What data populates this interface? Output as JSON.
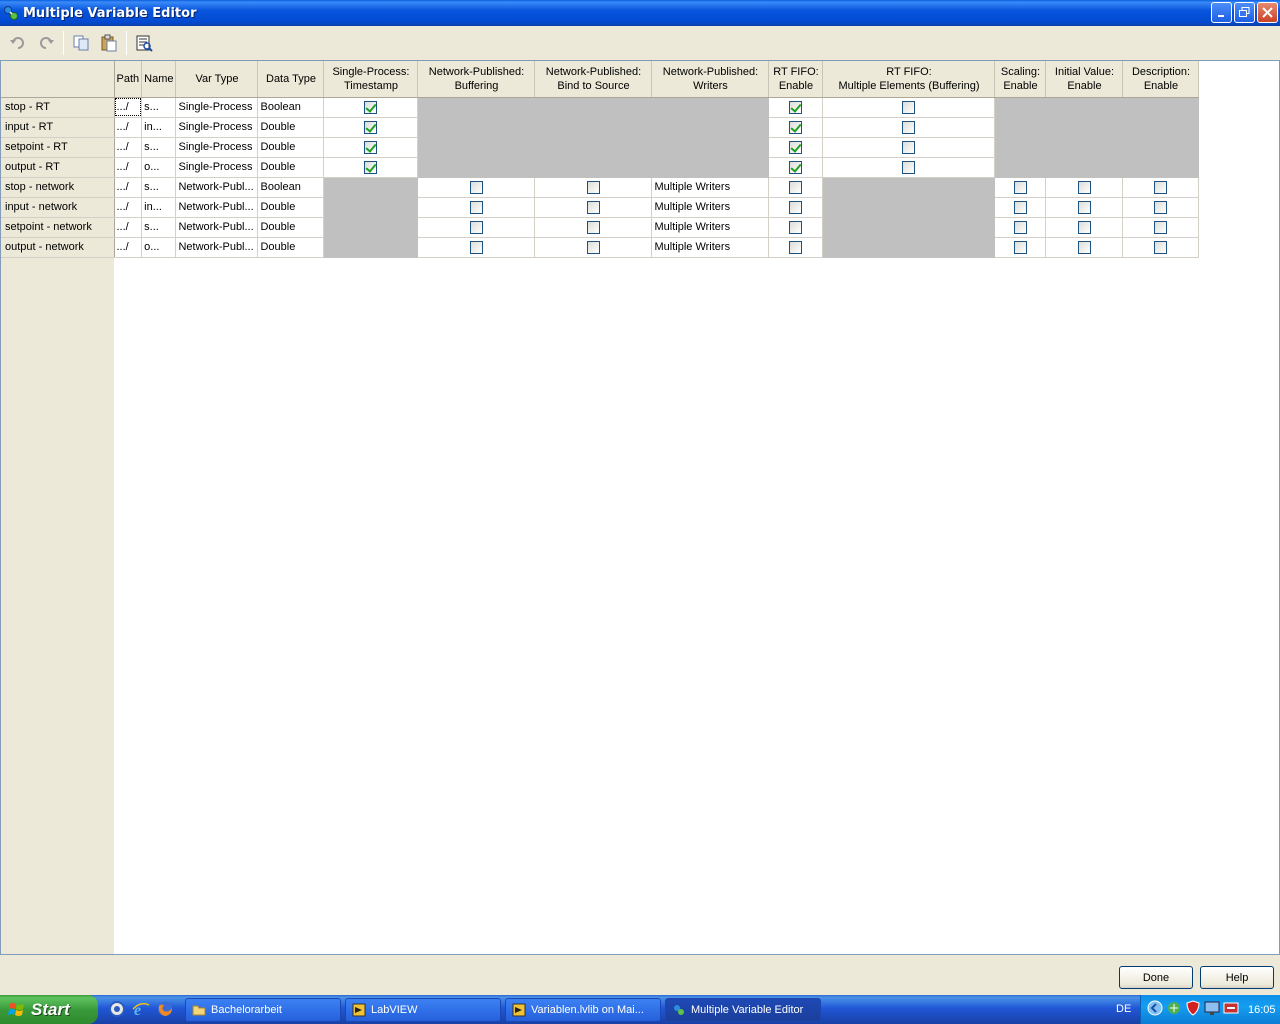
{
  "window": {
    "title": "Multiple Variable Editor"
  },
  "toolbar": {
    "icons": [
      "undo-icon",
      "redo-icon",
      "copy-icon",
      "paste-icon",
      "browse-icon"
    ]
  },
  "grid": {
    "columns": [
      {
        "key": "path",
        "label": "Path"
      },
      {
        "key": "name",
        "label": "Name"
      },
      {
        "key": "vartype",
        "label": "Var Type"
      },
      {
        "key": "datatype",
        "label": "Data Type"
      },
      {
        "key": "sp_ts",
        "label": "Single-Process:\nTimestamp"
      },
      {
        "key": "np_buf",
        "label": "Network-Published:\nBuffering"
      },
      {
        "key": "np_bind",
        "label": "Network-Published:\nBind to Source"
      },
      {
        "key": "np_writers",
        "label": "Network-Published:\nWriters"
      },
      {
        "key": "rt_en",
        "label": "RT FIFO:\nEnable"
      },
      {
        "key": "rt_multi",
        "label": "RT FIFO:\nMultiple Elements (Buffering)"
      },
      {
        "key": "sc_en",
        "label": "Scaling:\nEnable"
      },
      {
        "key": "iv_en",
        "label": "Initial Value:\nEnable"
      },
      {
        "key": "ds_en",
        "label": "Description:\nEnable"
      }
    ],
    "rows": [
      {
        "label": "stop - RT",
        "path": ".../",
        "name": "s...",
        "vartype": "Single-Process",
        "datatype": "Boolean",
        "sp_ts": true,
        "np_buf": null,
        "np_bind": null,
        "np_writers": null,
        "rt_en": true,
        "rt_multi": false,
        "sc_en": null,
        "iv_en": null,
        "ds_en": null
      },
      {
        "label": "input - RT",
        "path": ".../",
        "name": "in...",
        "vartype": "Single-Process",
        "datatype": "Double",
        "sp_ts": true,
        "np_buf": null,
        "np_bind": null,
        "np_writers": null,
        "rt_en": true,
        "rt_multi": false,
        "sc_en": null,
        "iv_en": null,
        "ds_en": null
      },
      {
        "label": "setpoint - RT",
        "path": ".../",
        "name": "s...",
        "vartype": "Single-Process",
        "datatype": "Double",
        "sp_ts": true,
        "np_buf": null,
        "np_bind": null,
        "np_writers": null,
        "rt_en": true,
        "rt_multi": false,
        "sc_en": null,
        "iv_en": null,
        "ds_en": null
      },
      {
        "label": "output - RT",
        "path": ".../",
        "name": "o...",
        "vartype": "Single-Process",
        "datatype": "Double",
        "sp_ts": true,
        "np_buf": null,
        "np_bind": null,
        "np_writers": null,
        "rt_en": true,
        "rt_multi": false,
        "sc_en": null,
        "iv_en": null,
        "ds_en": null
      },
      {
        "label": "stop - network",
        "path": ".../",
        "name": "s...",
        "vartype": "Network-Publ...",
        "datatype": "Boolean",
        "sp_ts": null,
        "np_buf": false,
        "np_bind": false,
        "np_writers": "Multiple Writers",
        "rt_en": false,
        "rt_multi": null,
        "sc_en": false,
        "iv_en": false,
        "ds_en": false
      },
      {
        "label": "input - network",
        "path": ".../",
        "name": "in...",
        "vartype": "Network-Publ...",
        "datatype": "Double",
        "sp_ts": null,
        "np_buf": false,
        "np_bind": false,
        "np_writers": "Multiple Writers",
        "rt_en": false,
        "rt_multi": null,
        "sc_en": false,
        "iv_en": false,
        "ds_en": false
      },
      {
        "label": "setpoint - network",
        "path": ".../",
        "name": "s...",
        "vartype": "Network-Publ...",
        "datatype": "Double",
        "sp_ts": null,
        "np_buf": false,
        "np_bind": false,
        "np_writers": "Multiple Writers",
        "rt_en": false,
        "rt_multi": null,
        "sc_en": false,
        "iv_en": false,
        "ds_en": false
      },
      {
        "label": "output - network",
        "path": ".../",
        "name": "o...",
        "vartype": "Network-Publ...",
        "datatype": "Double",
        "sp_ts": null,
        "np_buf": false,
        "np_bind": false,
        "np_writers": "Multiple Writers",
        "rt_en": false,
        "rt_multi": null,
        "sc_en": false,
        "iv_en": false,
        "ds_en": false
      }
    ]
  },
  "buttons": {
    "done": "Done",
    "help": "Help"
  },
  "taskbar": {
    "start": "Start",
    "tasks": [
      {
        "label": "Bachelorarbeit",
        "icon": "folder-icon",
        "active": false
      },
      {
        "label": "LabVIEW",
        "icon": "labview-icon",
        "active": false
      },
      {
        "label": "Variablen.lvlib on Mai...",
        "icon": "labview-icon",
        "active": false
      },
      {
        "label": "Multiple Variable Editor",
        "icon": "variable-editor-icon",
        "active": true
      }
    ],
    "language": "DE",
    "clock": "16:05"
  }
}
